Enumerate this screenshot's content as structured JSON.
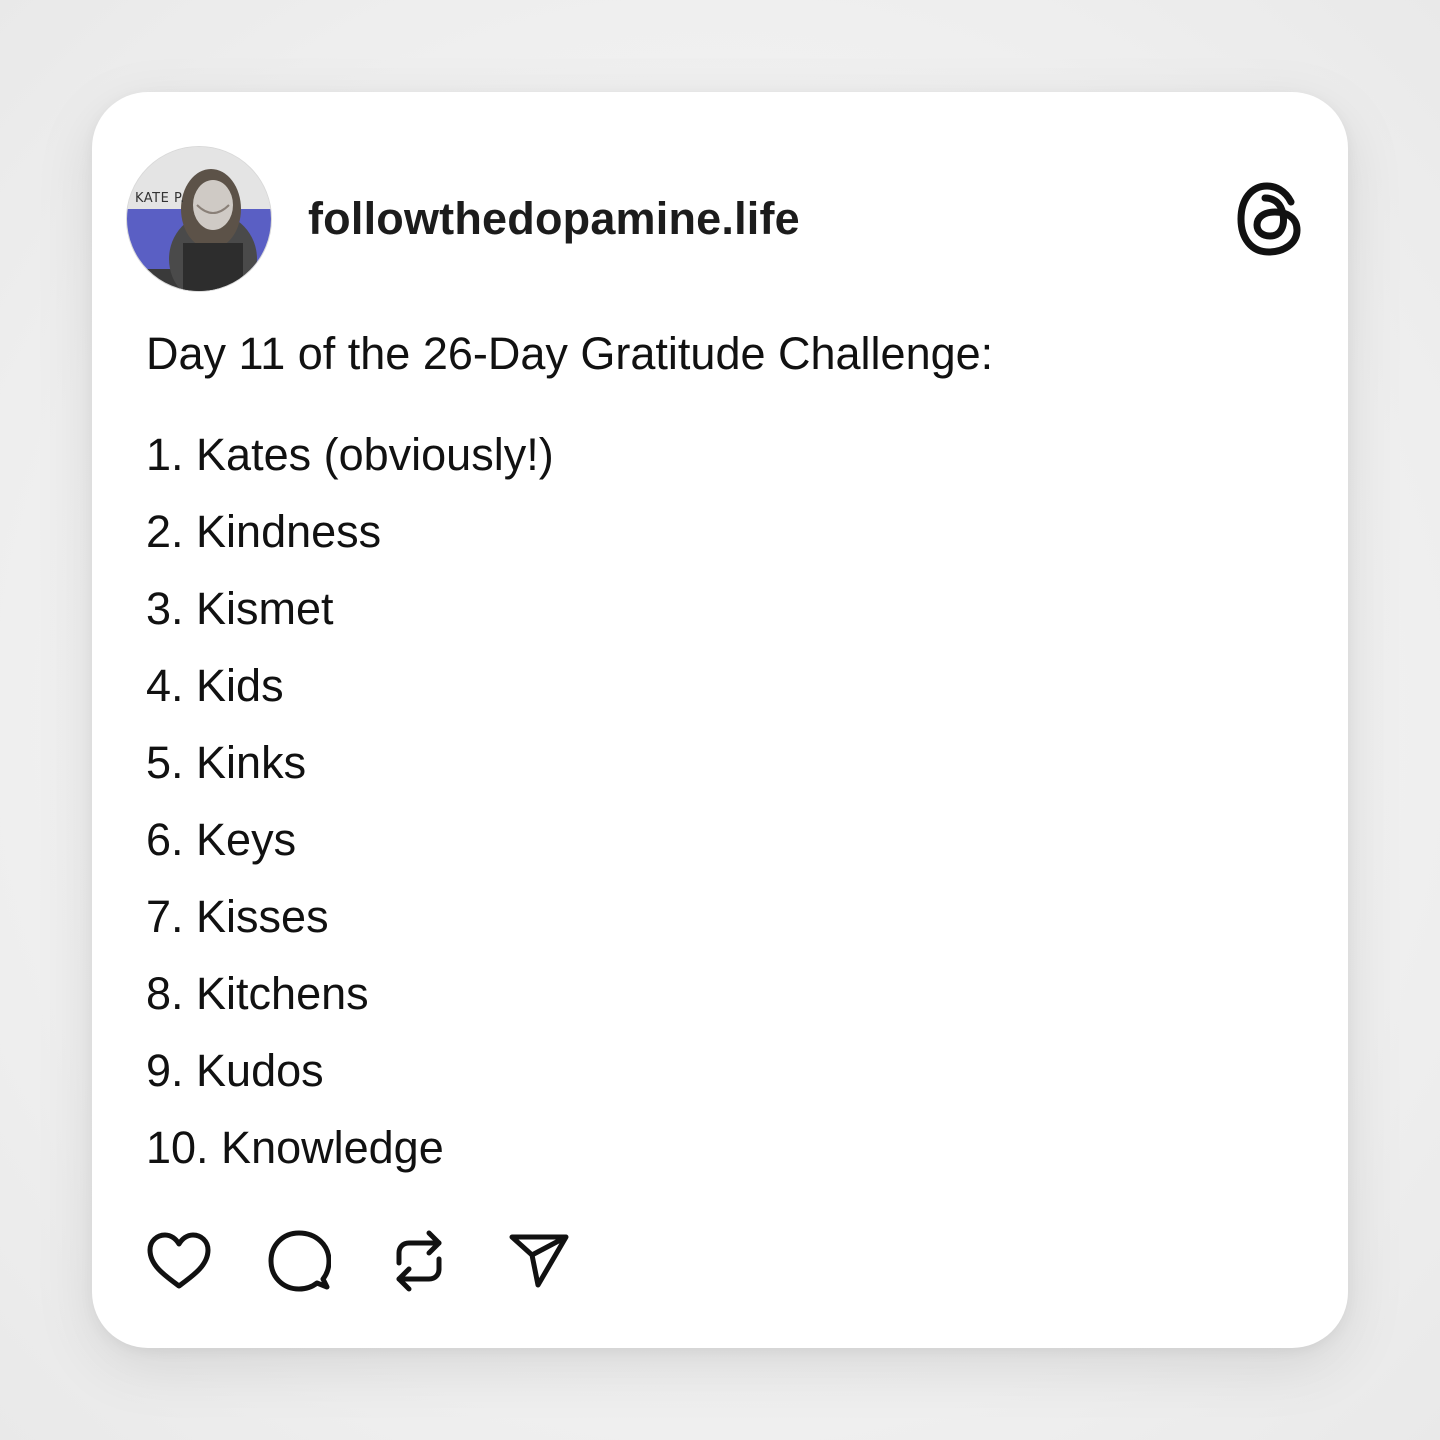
{
  "post": {
    "username": "followthedopamine.life",
    "avatar_text": "KATE P.",
    "intro": "Day 11 of the 26-Day Gratitude Challenge:",
    "items": [
      "1. Kates (obviously!)",
      "2. Kindness",
      "3. Kismet",
      "4. Kids",
      "5. Kinks",
      "6. Keys",
      "7. Kisses",
      "8. Kitchens",
      "9. Kudos",
      "10. Knowledge"
    ]
  },
  "icons": {
    "brand": "threads-logo-icon",
    "like": "heart-icon",
    "reply": "comment-icon",
    "repost": "repost-icon",
    "share": "send-icon"
  },
  "colors": {
    "background": "#efefef",
    "card": "#ffffff",
    "text": "#111111",
    "avatar_accent": "#5a5fc4"
  }
}
